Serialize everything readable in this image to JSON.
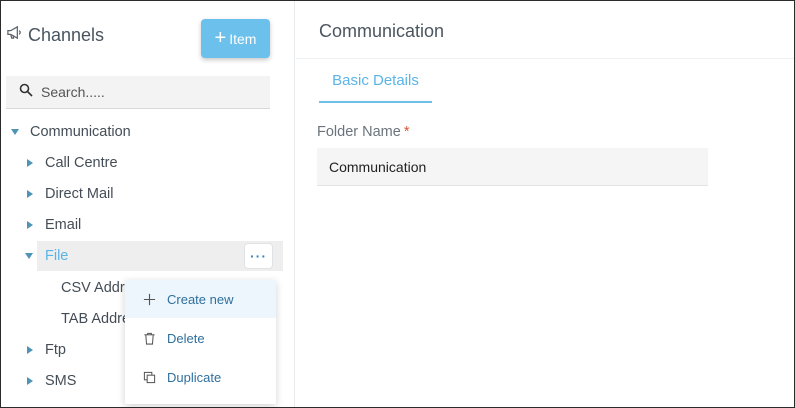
{
  "sidebar": {
    "title": "Channels",
    "add_button": {
      "plus": "+",
      "label": "Item"
    },
    "search": {
      "placeholder": "Search.....",
      "value": ""
    },
    "tree": {
      "root": "Communication",
      "items": {
        "call_centre": "Call Centre",
        "direct_mail": "Direct Mail",
        "email": "Email",
        "file": "File",
        "csv": "CSV Addre",
        "tab": "TAB Addre",
        "ftp": "Ftp",
        "sms": "SMS"
      }
    },
    "more_button": "···",
    "context_menu": {
      "create_new": "Create new",
      "delete": "Delete",
      "duplicate": "Duplicate"
    }
  },
  "main": {
    "title": "Communication",
    "tabs": [
      {
        "label": "Basic Details",
        "active": true
      }
    ],
    "form": {
      "folder_name_label": "Folder Name",
      "required_mark": "*",
      "folder_name_value": "Communication"
    }
  },
  "colors": {
    "accent": "#6cc1ec",
    "link": "#2f6f9e",
    "caret": "#4f93b7",
    "required": "#e0533b"
  }
}
